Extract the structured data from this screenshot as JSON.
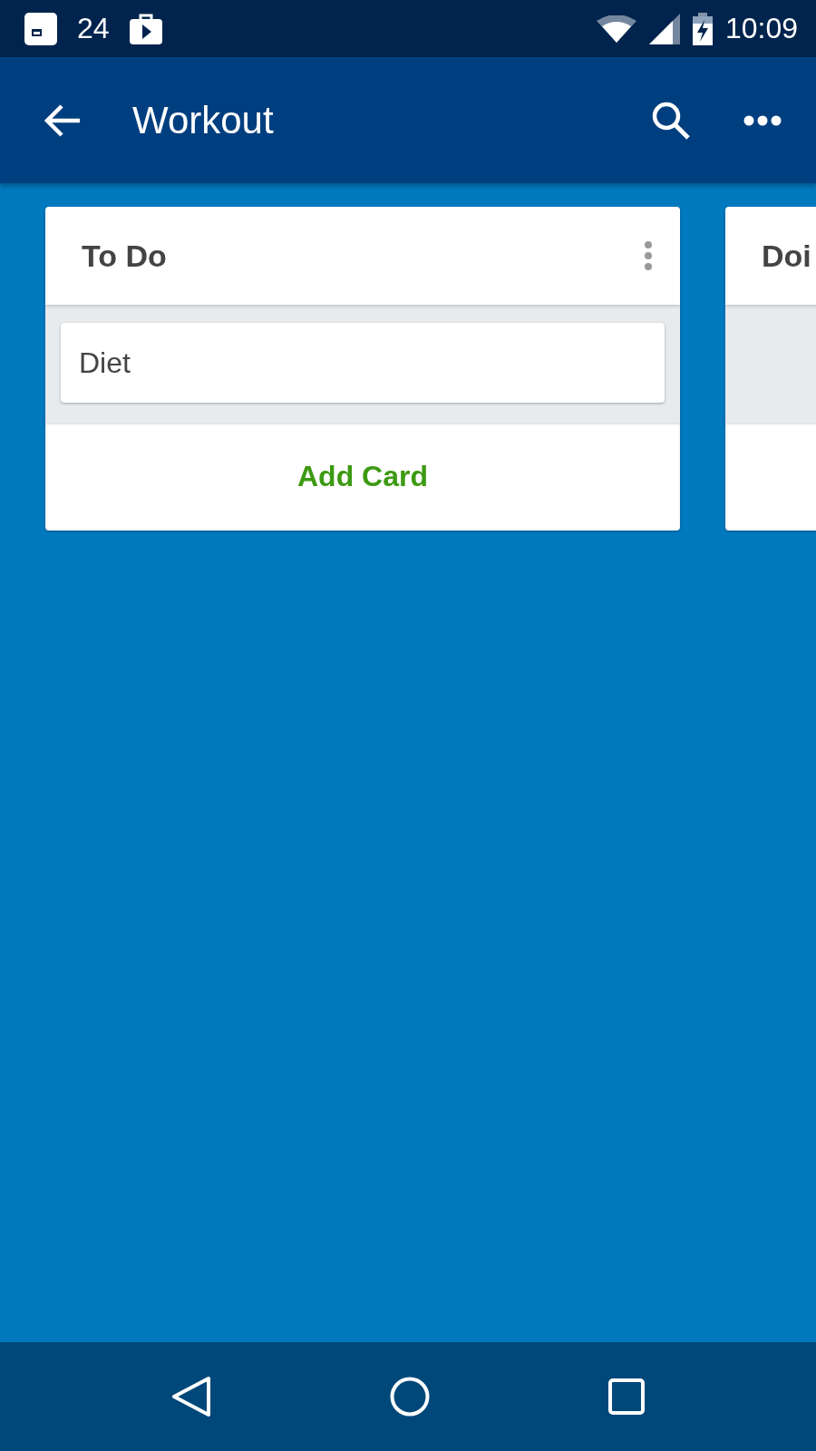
{
  "status_bar": {
    "notification_count": "24",
    "time": "10:09"
  },
  "app_bar": {
    "title": "Workout"
  },
  "lists": [
    {
      "title": "To Do",
      "cards": [
        {
          "title": "Diet"
        }
      ],
      "add_label": "Add Card"
    },
    {
      "title": "Doi"
    }
  ]
}
